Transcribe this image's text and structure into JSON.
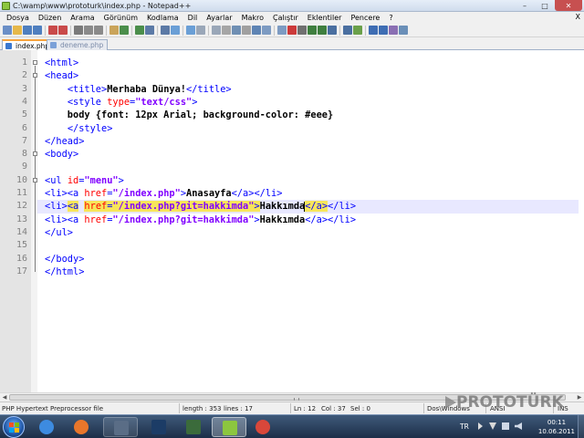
{
  "window": {
    "title": "C:\\wamp\\www\\prototurk\\index.php - Notepad++",
    "buttons": {
      "minimize": "–",
      "maximize": "□",
      "close": "✕"
    }
  },
  "menu": {
    "items": [
      "Dosya",
      "Düzen",
      "Arama",
      "Görünüm",
      "Kodlama",
      "Dil",
      "Ayarlar",
      "Makro",
      "Çalıştır",
      "Eklentiler",
      "Pencere",
      "?"
    ],
    "close": "X"
  },
  "toolbar": {
    "icons": [
      "new-file",
      "open-file",
      "save",
      "save-all",
      "close",
      "close-all",
      "print",
      "cut",
      "copy",
      "paste",
      "undo",
      "redo",
      "find",
      "replace",
      "zoom-in",
      "zoom-out",
      "sync-v",
      "sync-h",
      "word-wrap",
      "show-all",
      "indent-guide",
      "lang",
      "doc-map",
      "func-list",
      "record",
      "stop",
      "play",
      "play-multi",
      "save-macro",
      "run",
      "spell-check",
      "up",
      "down",
      "compare",
      "plugin"
    ]
  },
  "tabs": [
    {
      "label": "index.php",
      "active": true,
      "icon_color": "#3a78d0"
    },
    {
      "label": "deneme.php",
      "active": false,
      "icon_color": "#7aa0d8"
    }
  ],
  "editor": {
    "current_line": 12,
    "line_numbers": [
      "1",
      "2",
      "3",
      "4",
      "5",
      "6",
      "7",
      "8",
      "9",
      "10",
      "11",
      "12",
      "13",
      "14",
      "15",
      "16",
      "17"
    ],
    "lines": [
      [
        {
          "t": "tag",
          "v": "<html>"
        }
      ],
      [
        {
          "t": "tag",
          "v": "<head>"
        }
      ],
      [
        {
          "t": "txt",
          "v": "    "
        },
        {
          "t": "tag",
          "v": "<title>"
        },
        {
          "t": "txt",
          "v": "Merhaba Dünya!"
        },
        {
          "t": "tag",
          "v": "</title>"
        }
      ],
      [
        {
          "t": "txt",
          "v": "    "
        },
        {
          "t": "tag",
          "v": "<style "
        },
        {
          "t": "attr",
          "v": "type"
        },
        {
          "t": "tag",
          "v": "="
        },
        {
          "t": "str",
          "v": "\"text/css\""
        },
        {
          "t": "tag",
          "v": ">"
        }
      ],
      [
        {
          "t": "txt",
          "v": "    body {font: 12px Arial; background-color: #eee}"
        }
      ],
      [
        {
          "t": "txt",
          "v": "    "
        },
        {
          "t": "tag",
          "v": "</style>"
        }
      ],
      [
        {
          "t": "tag",
          "v": "</head>"
        }
      ],
      [
        {
          "t": "tag",
          "v": "<body>"
        }
      ],
      [],
      [
        {
          "t": "tag",
          "v": "<ul "
        },
        {
          "t": "attr",
          "v": "id"
        },
        {
          "t": "tag",
          "v": "="
        },
        {
          "t": "str",
          "v": "\"menu\""
        },
        {
          "t": "tag",
          "v": ">"
        }
      ],
      [
        {
          "t": "tag",
          "v": "<li><a "
        },
        {
          "t": "attr",
          "v": "href"
        },
        {
          "t": "tag",
          "v": "="
        },
        {
          "t": "str",
          "v": "\"/index.php\""
        },
        {
          "t": "tag",
          "v": ">"
        },
        {
          "t": "txt",
          "v": "Anasayfa"
        },
        {
          "t": "tag",
          "v": "</a></li>"
        }
      ],
      [
        {
          "t": "tag",
          "v": "<li>"
        },
        {
          "t": "tag hl",
          "v": "<a"
        },
        {
          "t": "tag",
          "v": " "
        },
        {
          "t": "attr hl",
          "v": "href"
        },
        {
          "t": "tag hl",
          "v": "="
        },
        {
          "t": "str hl",
          "v": "\"/index.php?git=hakkimda\""
        },
        {
          "t": "tag hl",
          "v": ">"
        },
        {
          "t": "txt",
          "v": "Hakkımda"
        },
        {
          "t": "caret",
          "v": ""
        },
        {
          "t": "tag hl",
          "v": "</a>"
        },
        {
          "t": "tag",
          "v": "</li>"
        }
      ],
      [
        {
          "t": "tag",
          "v": "<li><a "
        },
        {
          "t": "attr",
          "v": "href"
        },
        {
          "t": "tag",
          "v": "="
        },
        {
          "t": "str",
          "v": "\"/index.php?git=hakkimda\""
        },
        {
          "t": "tag",
          "v": ">"
        },
        {
          "t": "txt",
          "v": "Hakkımda"
        },
        {
          "t": "tag",
          "v": "</a></li>"
        }
      ],
      [
        {
          "t": "tag",
          "v": "</ul>"
        }
      ],
      [],
      [
        {
          "t": "tag",
          "v": "</body>"
        }
      ],
      [
        {
          "t": "tag",
          "v": "</html>"
        }
      ]
    ]
  },
  "statusbar": {
    "file_type": "PHP Hypertext Preprocessor file",
    "length": "length : 353",
    "lines": "lines : 17",
    "ln": "Ln : 12",
    "col": "Col : 37",
    "sel": "Sel : 0",
    "eol": "Dos\\Windows",
    "encoding": "ANSI",
    "mode": "INS"
  },
  "watermark": "PROTOTÜRK",
  "taskbar": {
    "apps": [
      {
        "name": "internet-explorer",
        "color": "#3d8be0"
      },
      {
        "name": "firefox",
        "color": "#e8762b"
      },
      {
        "name": "explorer-window",
        "color": "#5a6d86"
      },
      {
        "name": "photoshop",
        "color": "#1c3c66"
      },
      {
        "name": "wamp",
        "color": "#3b6b3b"
      },
      {
        "name": "media",
        "color": "#5b5b5b"
      },
      {
        "name": "notepad-plus-plus",
        "color": "#8cc63f"
      },
      {
        "name": "chrome",
        "color": "#d9473a"
      }
    ],
    "language": "TR",
    "time": "00:11",
    "date": "10.06.2011"
  }
}
